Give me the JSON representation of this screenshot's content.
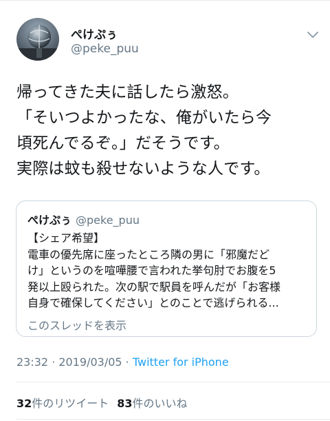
{
  "author": {
    "display_name": "ぺけぷぅ",
    "handle": "@peke_puu"
  },
  "tweet": {
    "text": "帰ってきた夫に話したら激怒。\n「そいつよかったな、俺がいたら今\n頃死んでるぞ。」だそうです。\n実際は蚊も殺せないような人です。"
  },
  "quoted_tweet": {
    "display_name": "ぺけぷぅ",
    "handle": "@peke_puu",
    "text": "【シェア希望】\n電車の優先席に座ったところ隣の男に「邪魔だど\nけ」というのを喧嘩腰で言われた挙句肘でお腹を5\n発以上殴られた。次の駅で駅員を呼んだが「お客様\n自身で確保してください」とのことで逃げられる...",
    "show_thread": "このスレッドを表示"
  },
  "meta": {
    "time": "23:32",
    "separator": " · ",
    "date": "2019/03/05",
    "source": "Twitter for iPhone"
  },
  "stats": {
    "retweets_count": "32",
    "retweets_label": "件のリツイート",
    "likes_count": "83",
    "likes_label": "件のいいね"
  },
  "colors": {
    "text": "#14171a",
    "muted": "#657786",
    "link": "#1da1f2",
    "border": "#ccd6dd",
    "divider": "#e6ecf0"
  },
  "icons": {
    "avatar": "globe-statue-photo",
    "menu": "chevron-down-icon"
  }
}
